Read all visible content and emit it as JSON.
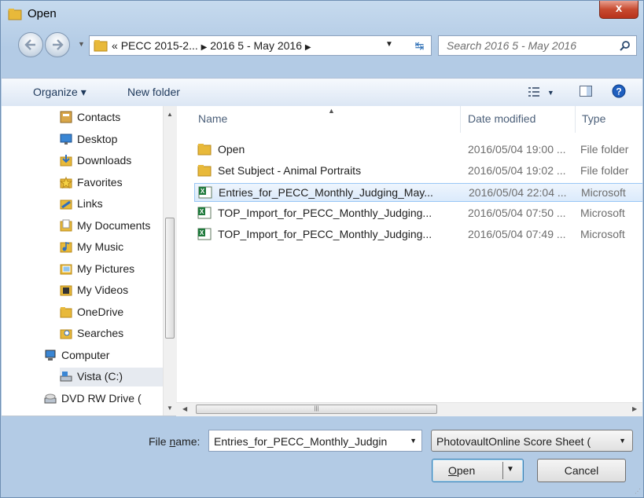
{
  "window": {
    "title": "Open",
    "close_label": "x"
  },
  "nav": {
    "address_prefix": "«",
    "breadcrumbs": [
      "PECC 2015-2...",
      "2016 5 - May 2016"
    ],
    "search_placeholder": "Search 2016 5 - May 2016"
  },
  "toolbar": {
    "organize": "Organize ▾",
    "new_folder": "New folder"
  },
  "tree": [
    {
      "label": "Contacts",
      "icon": "contacts-icon"
    },
    {
      "label": "Desktop",
      "icon": "desktop-icon"
    },
    {
      "label": "Downloads",
      "icon": "downloads-icon"
    },
    {
      "label": "Favorites",
      "icon": "favorites-icon"
    },
    {
      "label": "Links",
      "icon": "links-icon"
    },
    {
      "label": "My Documents",
      "icon": "documents-icon"
    },
    {
      "label": "My Music",
      "icon": "music-icon"
    },
    {
      "label": "My Pictures",
      "icon": "pictures-icon"
    },
    {
      "label": "My Videos",
      "icon": "videos-icon"
    },
    {
      "label": "OneDrive",
      "icon": "folder-icon"
    },
    {
      "label": "Searches",
      "icon": "searches-icon"
    },
    {
      "label": "Computer",
      "icon": "computer-icon"
    },
    {
      "label": "Vista (C:)",
      "icon": "drive-icon"
    },
    {
      "label": "DVD RW Drive (",
      "icon": "dvd-drive-icon"
    }
  ],
  "columns": {
    "name": "Name",
    "date": "Date modified",
    "type": "Type"
  },
  "files": [
    {
      "name": "Open",
      "date": "2016/05/04 19:00 ...",
      "type": "File folder",
      "kind": "folder"
    },
    {
      "name": "Set Subject - Animal Portraits",
      "date": "2016/05/04 19:02 ...",
      "type": "File folder",
      "kind": "folder"
    },
    {
      "name": "Entries_for_PECC_Monthly_Judging_May...",
      "date": "2016/05/04 22:04 ...",
      "type": "Microsoft",
      "kind": "excel"
    },
    {
      "name": "TOP_Import_for_PECC_Monthly_Judging...",
      "date": "2016/05/04 07:50 ...",
      "type": "Microsoft",
      "kind": "excel"
    },
    {
      "name": "TOP_Import_for_PECC_Monthly_Judging...",
      "date": "2016/05/04 07:49 ...",
      "type": "Microsoft",
      "kind": "excel"
    }
  ],
  "bottom": {
    "file_name_label_pre": "File ",
    "file_name_label_u": "n",
    "file_name_label_post": "ame:",
    "file_name_value": "Entries_for_PECC_Monthly_Judgin",
    "file_type_value": "PhotovaultOnline Score Sheet (",
    "open_u": "O",
    "open_rest": "pen",
    "cancel": "Cancel"
  },
  "colors": {
    "folder": "#e8b93a",
    "excel": "#1f7a3c",
    "selection": "#dbeafb"
  }
}
